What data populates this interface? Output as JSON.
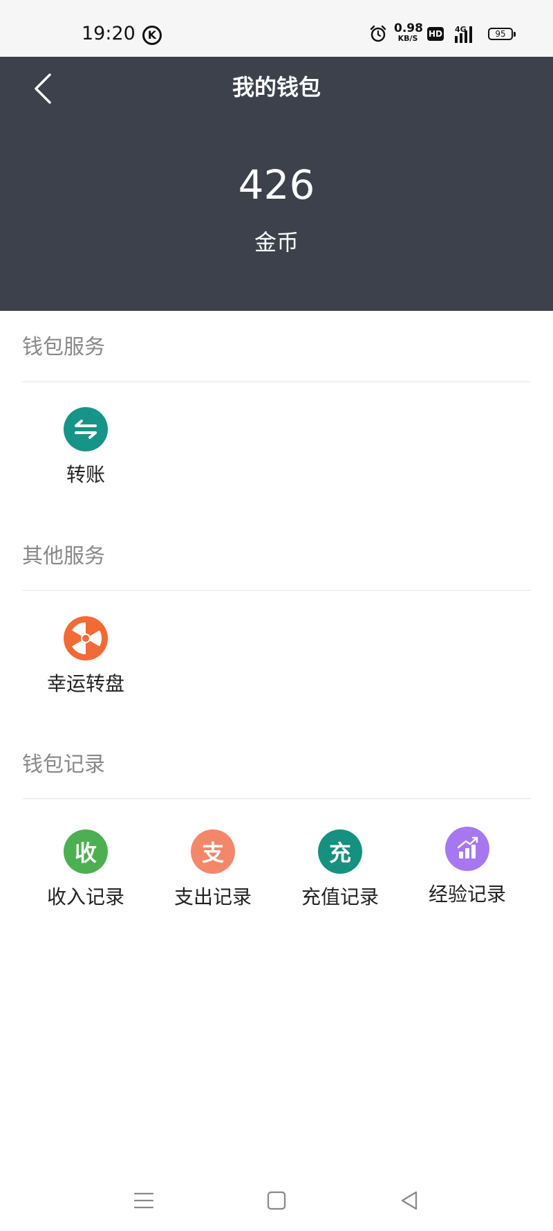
{
  "status_bar": {
    "time": "19:20",
    "carrier_badge": "K",
    "net_speed_value": "0.98",
    "net_speed_unit": "KB/S",
    "hd_badge": "HD",
    "network": "4G",
    "battery": "95"
  },
  "header": {
    "title": "我的钱包",
    "balance": "426",
    "balance_unit": "金币",
    "background_color": "#3c414c"
  },
  "sections": [
    {
      "title": "钱包服务",
      "items": [
        {
          "label": "转账",
          "icon": "transfer-icon",
          "color": "#179488"
        }
      ]
    },
    {
      "title": "其他服务",
      "items": [
        {
          "label": "幸运转盘",
          "icon": "lucky-wheel-icon",
          "color": "#f26a35"
        }
      ]
    },
    {
      "title": "钱包记录",
      "items": [
        {
          "label": "收入记录",
          "icon_text": "收",
          "icon": "income-icon",
          "color": "#4caf50"
        },
        {
          "label": "支出记录",
          "icon_text": "支",
          "icon": "expense-icon",
          "color": "#f3876a"
        },
        {
          "label": "充值记录",
          "icon_text": "充",
          "icon": "recharge-icon",
          "color": "#16907f"
        },
        {
          "label": "经验记录",
          "icon": "experience-chart-icon",
          "color": "#a777f0"
        }
      ]
    }
  ],
  "nav_bar": {
    "buttons": [
      "menu-icon",
      "home-icon",
      "back-icon"
    ]
  }
}
